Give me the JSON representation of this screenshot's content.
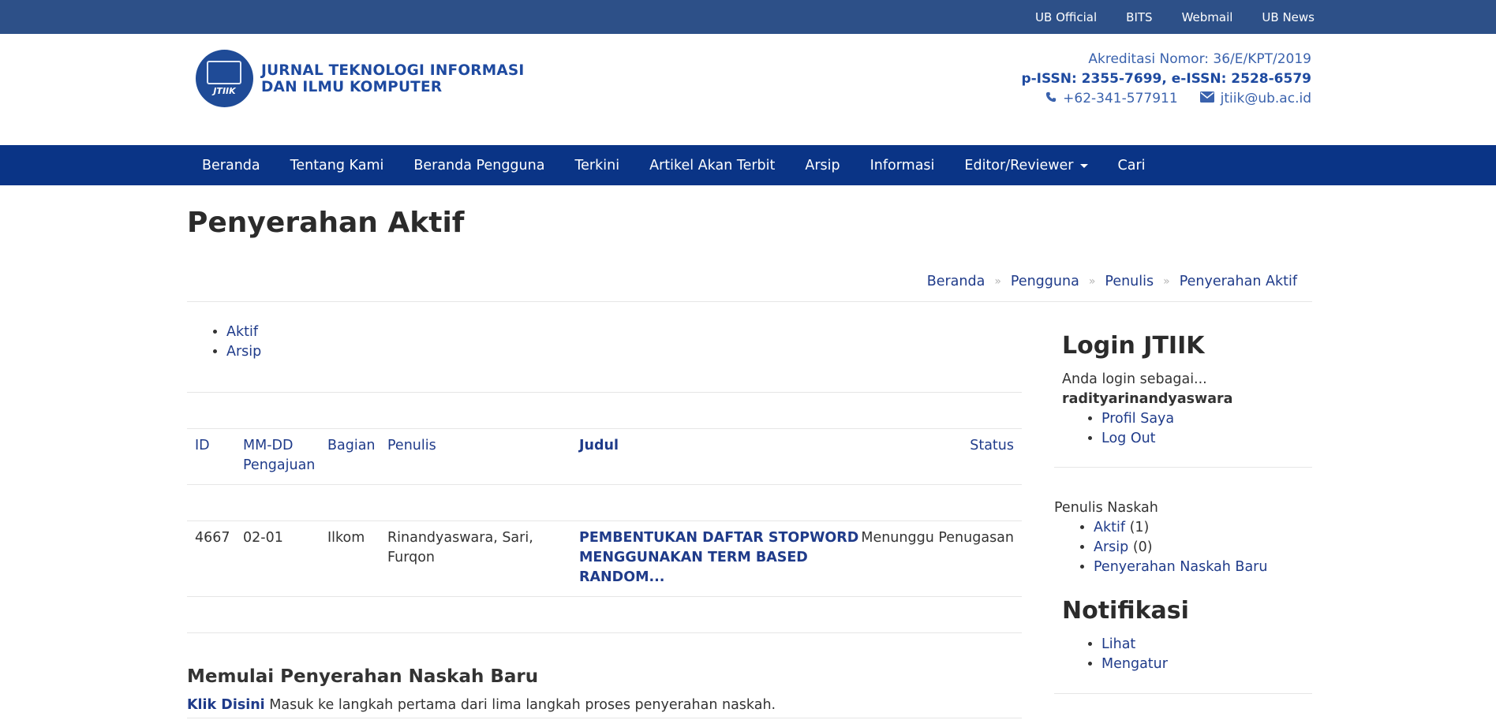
{
  "topbar": {
    "links": [
      "UB Official",
      "BITS",
      "Webmail",
      "UB News"
    ]
  },
  "header": {
    "logo_title_line1": "JURNAL TEKNOLOGI INFORMASI",
    "logo_title_line2": "DAN ILMU KOMPUTER",
    "logo_badge": "JTIIK",
    "accreditation": "Akreditasi Nomor: 36/E/KPT/2019",
    "issn": "p-ISSN: 2355-7699, e-ISSN: 2528-6579",
    "phone": "+62-341-577911",
    "email": "jtiik@ub.ac.id"
  },
  "nav": {
    "items": [
      "Beranda",
      "Tentang Kami",
      "Beranda Pengguna",
      "Terkini",
      "Artikel Akan Terbit",
      "Arsip",
      "Informasi",
      "Editor/Reviewer",
      "Cari"
    ]
  },
  "page": {
    "title": "Penyerahan Aktif",
    "breadcrumb": [
      "Beranda",
      "Pengguna",
      "Penulis",
      "Penyerahan Aktif"
    ],
    "breadcrumb_sep": "»",
    "tabs": [
      "Aktif",
      "Arsip"
    ]
  },
  "table": {
    "headers": {
      "id": "ID",
      "date_line1": "MM-DD",
      "date_line2": "Pengajuan",
      "section": "Bagian",
      "authors": "Penulis",
      "title": "Judul",
      "status": "Status"
    },
    "rows": [
      {
        "id": "4667",
        "date": "02-01",
        "section": "Ilkom",
        "authors_line1": "Rinandyaswara, Sari,",
        "authors_line2": "Furqon",
        "title_line1": "PEMBENTUKAN DAFTAR STOPWORD",
        "title_line2": "MENGGUNAKAN TERM BASED",
        "title_line3": "RANDOM...",
        "status": "Menunggu Penugasan"
      }
    ]
  },
  "new_submission": {
    "heading": "Memulai Penyerahan Naskah Baru",
    "link": "Klik Disini",
    "text": "Masuk ke langkah pertama dari lima langkah proses penyerahan naskah."
  },
  "sidebar": {
    "login_title": "Login JTIIK",
    "logged_in_as": "Anda login sebagai...",
    "username": "radityarinandyaswara",
    "user_links": [
      "Profil Saya",
      "Log Out"
    ],
    "author_heading": "Penulis Naskah",
    "author_active": "Aktif",
    "author_active_count": "(1)",
    "author_archive": "Arsip",
    "author_archive_count": "(0)",
    "author_new": "Penyerahan Naskah Baru",
    "notif_title": "Notifikasi",
    "notif_links": [
      "Lihat",
      "Mengatur"
    ]
  },
  "colors": {
    "topbar": "#2d5088",
    "nav": "#0a3486",
    "link": "#1f3b8a",
    "brand": "#1e4aa0"
  }
}
